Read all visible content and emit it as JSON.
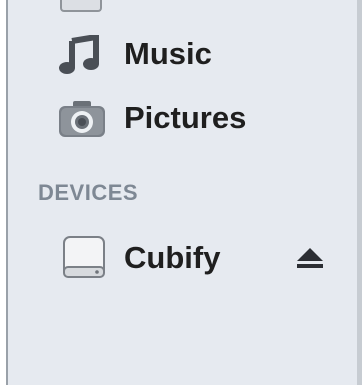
{
  "sidebar": {
    "items": [
      {
        "label": "Music",
        "icon": "music-note-icon"
      },
      {
        "label": "Pictures",
        "icon": "camera-icon"
      }
    ],
    "section": {
      "title": "DEVICES",
      "items": [
        {
          "label": "Cubify",
          "icon": "hard-drive-icon",
          "action_icon": "eject-icon"
        }
      ]
    }
  },
  "colors": {
    "background": "#e6eaf0",
    "section_header": "#7e8894",
    "text": "#1f1f1f"
  }
}
